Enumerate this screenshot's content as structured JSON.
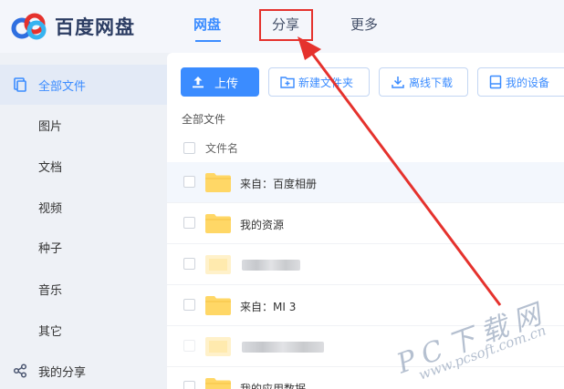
{
  "app": {
    "name": "百度网盘"
  },
  "nav": {
    "tabs": [
      {
        "label": "网盘"
      },
      {
        "label": "分享"
      },
      {
        "label": "更多"
      }
    ]
  },
  "sidebar": {
    "items": [
      {
        "label": "全部文件",
        "icon": "files-icon"
      },
      {
        "label": "图片"
      },
      {
        "label": "文档"
      },
      {
        "label": "视频"
      },
      {
        "label": "种子"
      },
      {
        "label": "音乐"
      },
      {
        "label": "其它"
      },
      {
        "label": "我的分享",
        "icon": "share-icon"
      }
    ]
  },
  "toolbar": {
    "upload": "上传",
    "new_folder": "新建文件夹",
    "offline_download": "离线下载",
    "my_devices": "我的设备"
  },
  "breadcrumb": "全部文件",
  "table": {
    "column_name": "文件名",
    "rows": [
      {
        "name": "来自：百度相册"
      },
      {
        "name": "我的资源"
      },
      {
        "name": ""
      },
      {
        "name": "来自：MI 3"
      },
      {
        "name": ""
      },
      {
        "name": "我的应用数据"
      }
    ]
  },
  "watermark": {
    "line1": "PC下载网",
    "line2": "www.pcsoft.com.cn"
  },
  "colors": {
    "accent": "#3b8cff",
    "highlight": "#e5322d",
    "folder": "#ffd766"
  }
}
